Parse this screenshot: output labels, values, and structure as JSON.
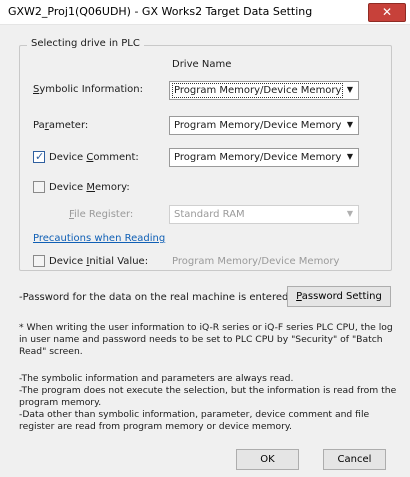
{
  "window": {
    "title": "GXW2_Proj1(Q06UDH) - GX Works2 Target Data Setting",
    "close_label": "✕"
  },
  "drive_group": {
    "legend": "Selecting drive in PLC",
    "column_header": "Drive Name",
    "symbolic": {
      "label_pre": "",
      "label_ul": "S",
      "label_post": "ymbolic Information:",
      "value": "Program Memory/Device Memory"
    },
    "parameter": {
      "label_pre": "Pa",
      "label_ul": "r",
      "label_post": "ameter:",
      "value": "Program Memory/Device Memory"
    },
    "device_comment": {
      "checked": true,
      "label_pre": "Device ",
      "label_ul": "C",
      "label_post": "omment:",
      "value": "Program Memory/Device Memory"
    },
    "device_memory": {
      "checked": false,
      "label_pre": "Device ",
      "label_ul": "M",
      "label_post": "emory:"
    },
    "file_register": {
      "label_pre": "",
      "label_ul": "F",
      "label_post": "ile Register:",
      "value": "Standard RAM"
    },
    "precautions_link": "Precautions when Reading",
    "device_initial": {
      "checked": false,
      "label_pre": "Device ",
      "label_ul": "I",
      "label_post": "nitial Value:",
      "value": "Program Memory/Device Memory"
    }
  },
  "password": {
    "text": "-Password for the data on the real machine is entered.",
    "button_ul": "P",
    "button_rest": "assword Setting"
  },
  "notes": {
    "note1_l1": "* When writing the user information to iQ-R series or iQ-F series PLC CPU, the log",
    "note1_l2": "in user name and password needs to be set to PLC CPU by \"Security\" of \"Batch",
    "note1_l3": "Read\" screen.",
    "note2_l1": "-The symbolic information and parameters are always read.",
    "note2_l2": "-The program does not execute the selection, but the information is read from the",
    "note2_l3": "program memory.",
    "note2_l4": "-Data other than symbolic information, parameter, device comment and file",
    "note2_l5": "register are read from program memory or device memory."
  },
  "footer": {
    "ok_label": "OK",
    "cancel_label": "Cancel"
  },
  "icons": {
    "dropdown": "▼",
    "checkmark": "✓"
  }
}
